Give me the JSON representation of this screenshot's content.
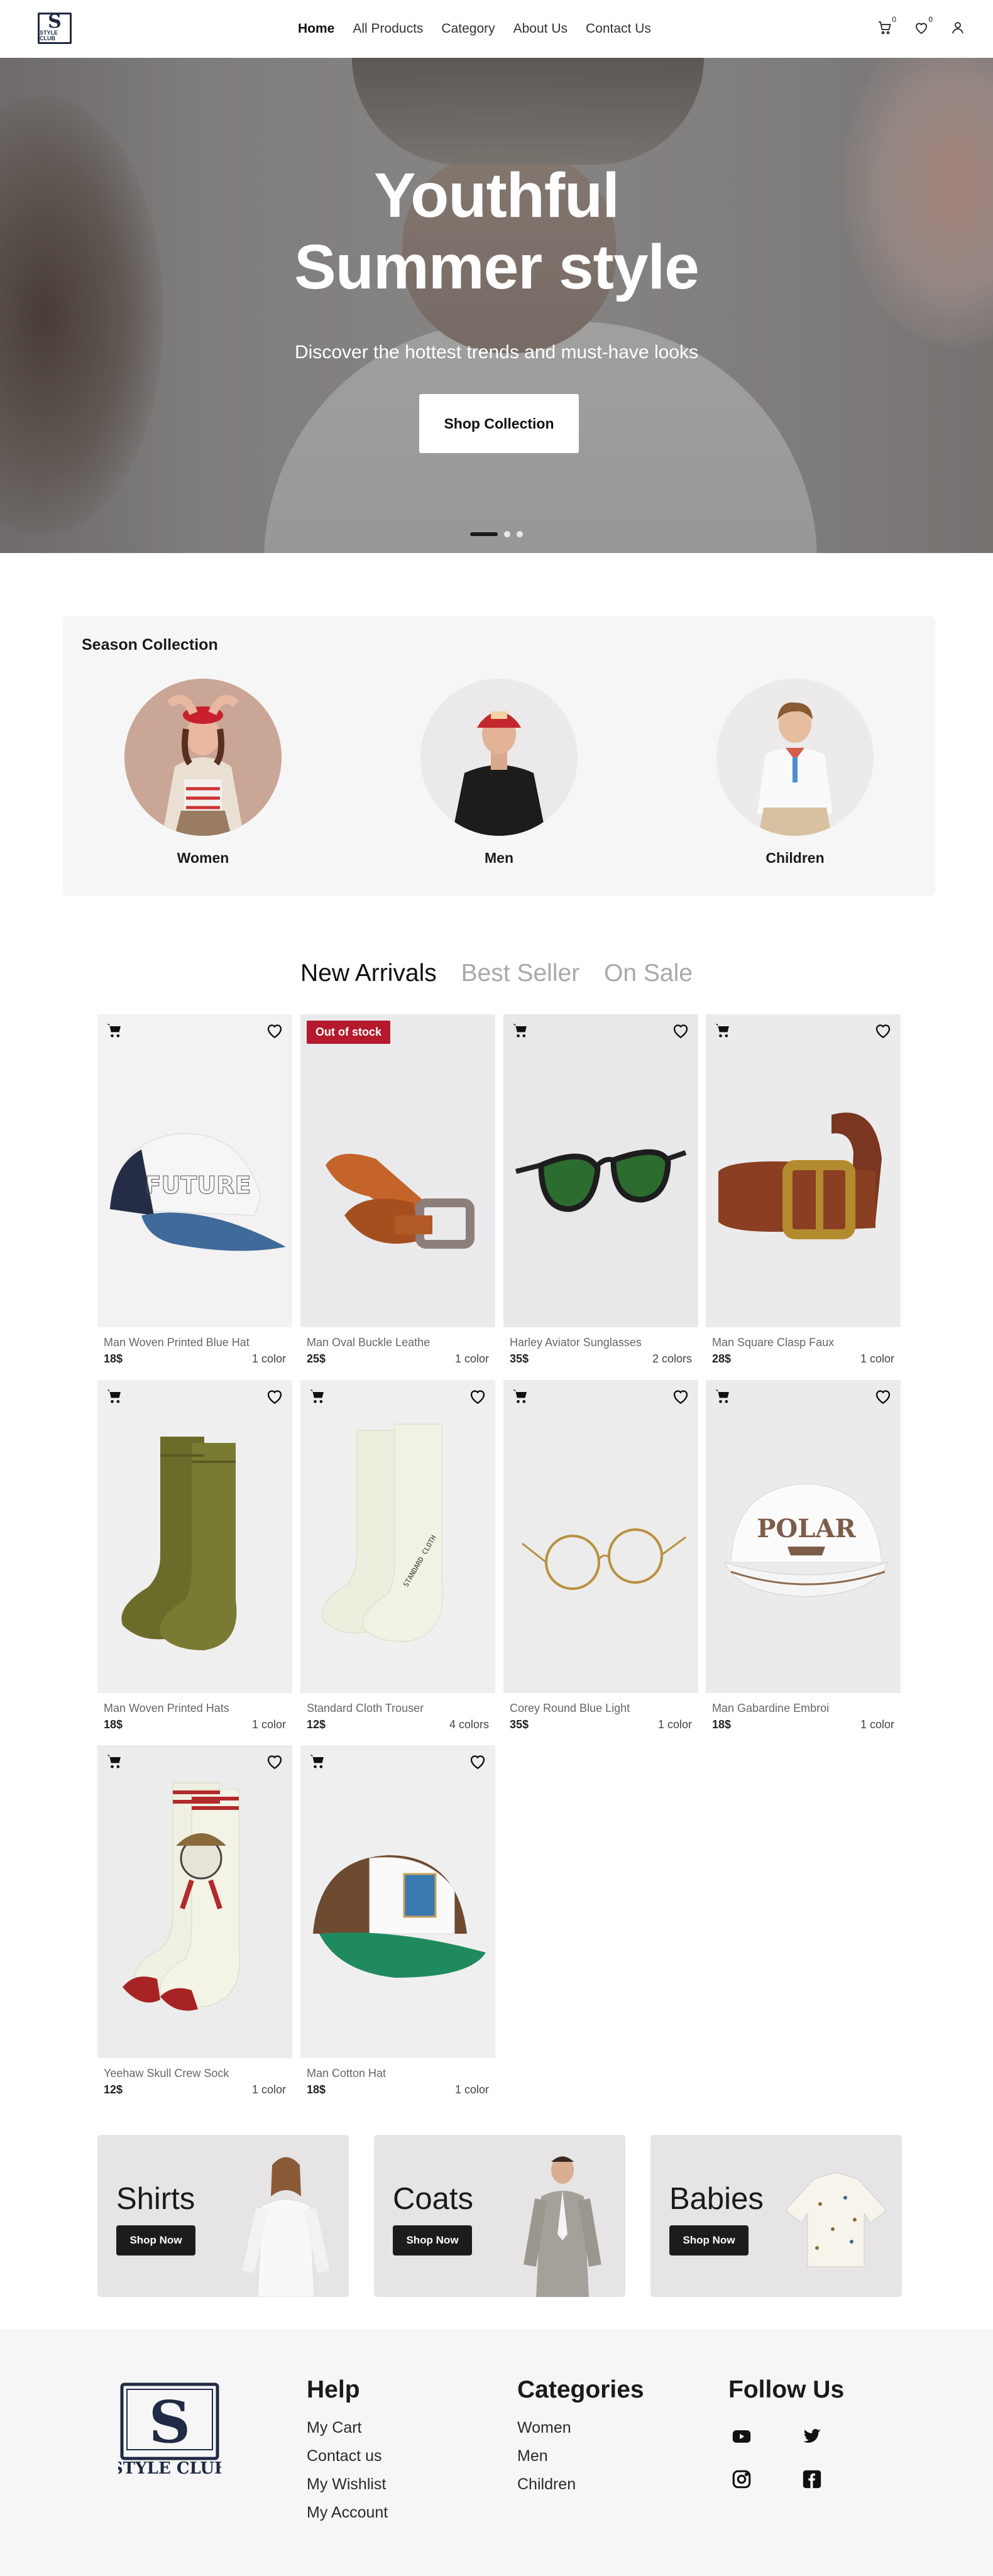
{
  "brand": {
    "logo_line1": "S",
    "logo_line2": "STYLE CLUB",
    "logo_small_text": "STYLE CLUB"
  },
  "nav": {
    "items": [
      {
        "label": "Home",
        "active": true
      },
      {
        "label": "All Products"
      },
      {
        "label": "Category"
      },
      {
        "label": "About Us"
      },
      {
        "label": "Contact Us"
      }
    ],
    "cart_count": "0",
    "wishlist_count": "0"
  },
  "hero": {
    "title_line1": "Youthful",
    "title_line2": "Summer style",
    "subtitle": "Discover the hottest trends and must-have looks",
    "cta": "Shop Collection",
    "slides": 3,
    "active_slide": 1
  },
  "season": {
    "title": "Season Collection",
    "items": [
      {
        "label": "Women"
      },
      {
        "label": "Men"
      },
      {
        "label": "Children"
      }
    ]
  },
  "tabs": [
    {
      "label": "New Arrivals",
      "active": true
    },
    {
      "label": "Best Seller"
    },
    {
      "label": "On Sale"
    }
  ],
  "products": [
    {
      "name": "Man Woven Printed Blue Hat",
      "price": "18$",
      "colors": "1 color",
      "image": "trucker-cap-blue"
    },
    {
      "name": "Man Oval Buckle Leathe",
      "price": "25$",
      "colors": "1 color",
      "image": "leather-belt-tan",
      "badge": "Out of stock"
    },
    {
      "name": "Harley Aviator Sunglasses",
      "price": "35$",
      "colors": "2 colors",
      "image": "green-sunglasses"
    },
    {
      "name": "Man Square Clasp Faux",
      "price": "28$",
      "colors": "1 color",
      "image": "brown-belt-brass"
    },
    {
      "name": "Man Woven Printed Hats",
      "price": "18$",
      "colors": "1 color",
      "image": "olive-socks"
    },
    {
      "name": "Standard Cloth Trouser",
      "price": "12$",
      "colors": "4 colors",
      "image": "cream-socks"
    },
    {
      "name": "Corey Round Blue Light",
      "price": "35$",
      "colors": "1 color",
      "image": "round-glasses"
    },
    {
      "name": "Man Gabardine Embroi",
      "price": "18$",
      "colors": "1 color",
      "image": "white-polar-cap"
    },
    {
      "name": "Yeehaw Skull Crew Sock",
      "price": "12$",
      "colors": "1 color",
      "image": "skull-socks"
    },
    {
      "name": "Man Cotton Hat",
      "price": "18$",
      "colors": "1 color",
      "image": "green-trucker-cap"
    }
  ],
  "promos": [
    {
      "title": "Shirts",
      "cta": "Shop Now"
    },
    {
      "title": "Coats",
      "cta": "Shop Now"
    },
    {
      "title": "Babies",
      "cta": "Shop Now"
    }
  ],
  "footer": {
    "help": {
      "title": "Help",
      "links": [
        "My Cart",
        "Contact us",
        "My Wishlist",
        "My Account"
      ]
    },
    "categories": {
      "title": "Categories",
      "links": [
        "Women",
        "Men",
        "Children"
      ]
    },
    "follow": {
      "title": "Follow Us",
      "icons": [
        "youtube-icon",
        "twitter-icon",
        "instagram-icon",
        "facebook-icon"
      ]
    }
  }
}
